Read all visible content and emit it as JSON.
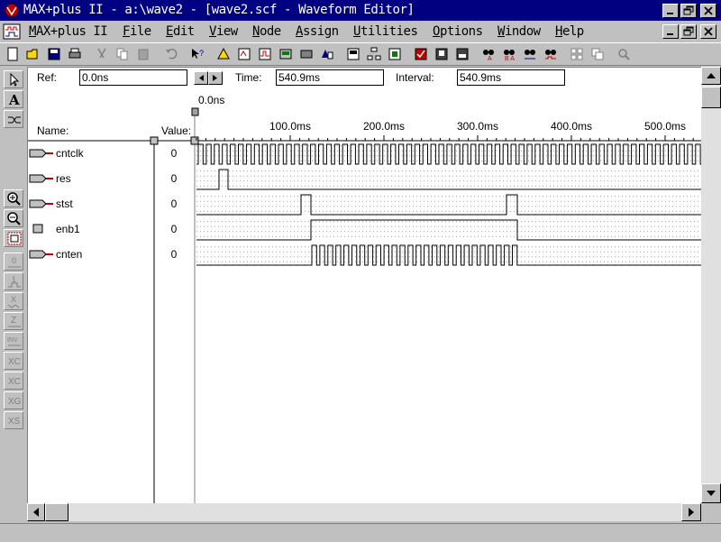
{
  "window": {
    "title": "MAX+plus II - a:\\wave2 - [wave2.scf - Waveform Editor]",
    "minimize_icon": "minimize-icon",
    "restore_icon": "restore-icon",
    "close_icon": "close-icon"
  },
  "menu": [
    {
      "pre": "",
      "u": "M",
      "post": "AX+plus II"
    },
    {
      "pre": "",
      "u": "F",
      "post": "ile"
    },
    {
      "pre": "",
      "u": "E",
      "post": "dit"
    },
    {
      "pre": "",
      "u": "V",
      "post": "iew"
    },
    {
      "pre": "",
      "u": "N",
      "post": "ode"
    },
    {
      "pre": "",
      "u": "A",
      "post": "ssign"
    },
    {
      "pre": "",
      "u": "U",
      "post": "tilities"
    },
    {
      "pre": "",
      "u": "O",
      "post": "ptions"
    },
    {
      "pre": "",
      "u": "W",
      "post": "indow"
    },
    {
      "pre": "",
      "u": "H",
      "post": "elp"
    }
  ],
  "toolbar_icons": [
    "new-icon",
    "open-icon",
    "save-icon",
    "print-icon",
    "cut-icon",
    "copy-icon",
    "paste-icon",
    "undo-icon",
    "help-pointer-icon",
    "hierarchy-up-icon",
    "compiler-icon",
    "simulator-icon",
    "timing-analyzer-icon",
    "programmer-icon",
    "open-project-icon",
    "save-project-icon",
    "hierarchy-display-icon",
    "floorplan-icon",
    "save-check-icon",
    "save-compile-icon",
    "save-simulate-icon",
    "find-node-icon",
    "find-node-assign-icon",
    "find-node-sim-icon",
    "find-node-scf-icon",
    "tile-icon",
    "cascade-icon",
    "search-icon"
  ],
  "palette_icons": [
    "select-tool-icon",
    "text-tool-icon",
    "waveform-draw-icon",
    "zoom-in-icon",
    "zoom-out-icon",
    "fit-window-icon",
    "low-level-icon",
    "high-level-icon",
    "unknown-x-icon",
    "high-impedance-z-icon",
    "invert-icon",
    "overwrite-clock-icon",
    "overwrite-count-icon",
    "overwrite-group-icon",
    "overwrite-state-icon"
  ],
  "header": {
    "ref_label": "Ref:",
    "ref_value": "0.0ns",
    "time_label": "Time:",
    "time_value": "540.9ms",
    "interval_label": "Interval:",
    "interval_value": "540.9ms",
    "ref_marker": "0.0ns",
    "name_label": "Name:",
    "value_label": "Value:"
  },
  "time_axis": {
    "ticks": [
      "100.0ms",
      "200.0ms",
      "300.0ms",
      "400.0ms",
      "500.0ms"
    ],
    "tick_values_ms": [
      100,
      200,
      300,
      400,
      500
    ]
  },
  "signals": [
    {
      "name": "cntclk",
      "value": "0",
      "kind": "input"
    },
    {
      "name": "res",
      "value": "0",
      "kind": "input"
    },
    {
      "name": "stst",
      "value": "0",
      "kind": "input"
    },
    {
      "name": "enb1",
      "value": "0",
      "kind": "buried"
    },
    {
      "name": "cnten",
      "value": "0",
      "kind": "output"
    }
  ],
  "colors": {
    "title_bar": "#000080",
    "face": "#c0c0c0",
    "canvas": "#ffffff",
    "grid": "#a0a0a0"
  }
}
